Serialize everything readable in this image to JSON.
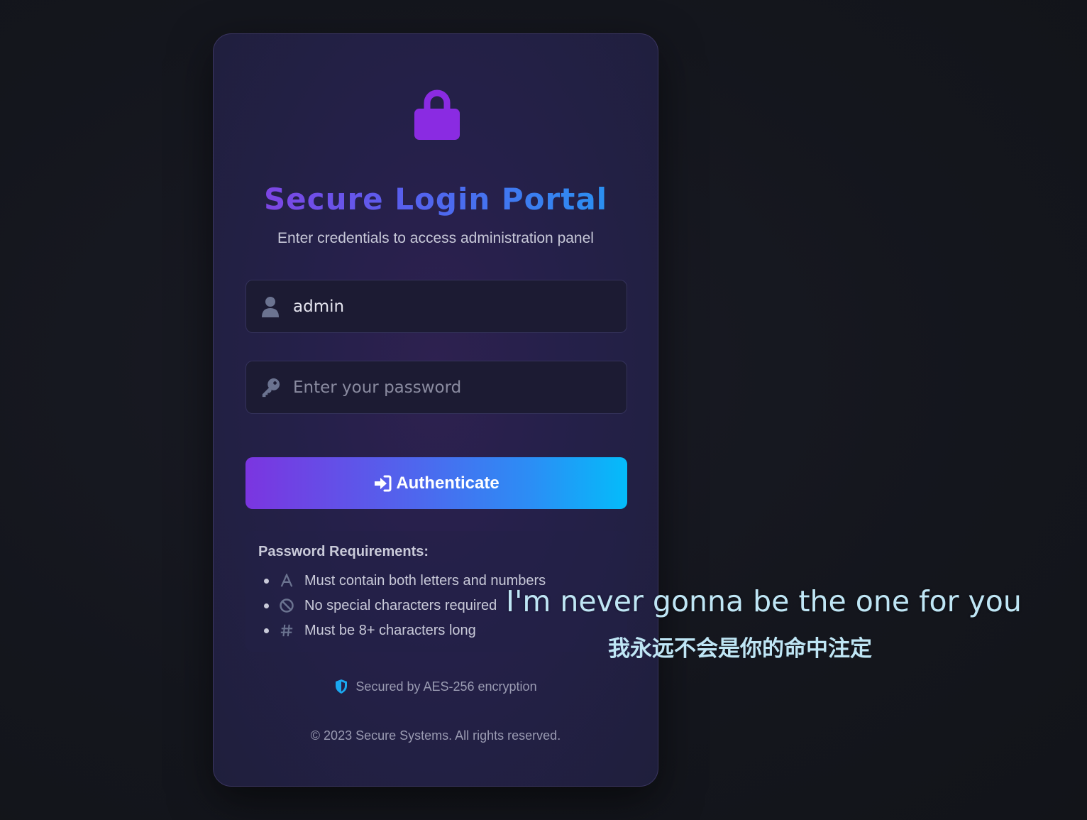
{
  "login": {
    "title": "Secure Login Portal",
    "subtitle": "Enter credentials to access administration panel",
    "username": {
      "value": "admin",
      "icon": "user-icon"
    },
    "password": {
      "placeholder": "Enter your password",
      "value": "",
      "icon": "key-icon"
    },
    "submit": {
      "label": "Authenticate",
      "icon": "sign-in-icon"
    },
    "requirements": {
      "title": "Password Requirements:",
      "items": [
        {
          "icon": "letter-a-icon",
          "text": "Must contain both letters and numbers"
        },
        {
          "icon": "ban-icon",
          "text": "No special characters required"
        },
        {
          "icon": "hash-icon",
          "text": "Must be 8+ characters long"
        }
      ]
    },
    "security_note": "Secured by AES-256 encryption",
    "copyright": "© 2023 Secure Systems. All rights reserved."
  },
  "subtitles": {
    "english": "I'm never gonna be the one for you",
    "chinese": "我永远不会是你的命中注定"
  },
  "colors": {
    "accent_purple": "#8b3ce0",
    "accent_cyan": "#04bcfa",
    "card_background": "#25204a",
    "page_background": "#14161d"
  }
}
